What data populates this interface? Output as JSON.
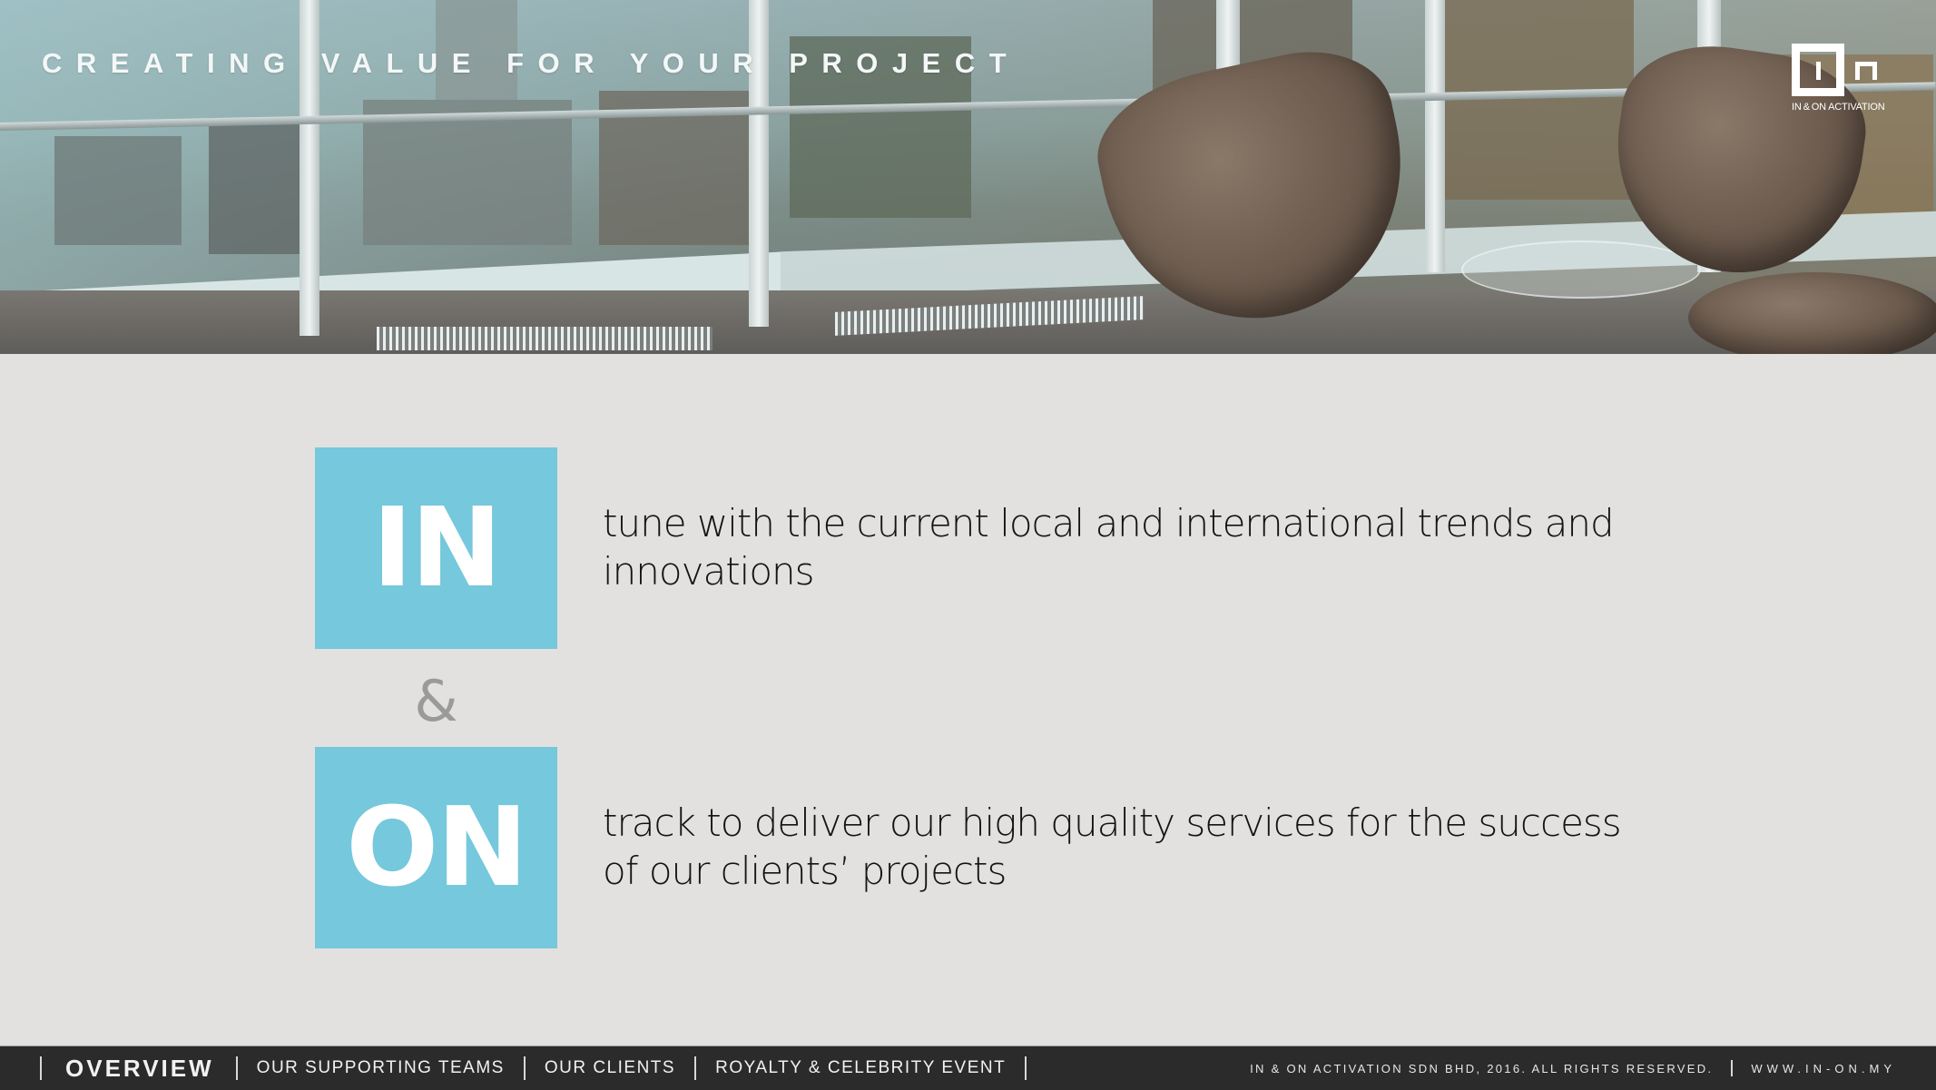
{
  "hero": {
    "title": "CREATING VALUE FOR YOUR PROJECT",
    "image_description": "office lounge with two brown chairs and glass table overlooking city skyline",
    "logo": {
      "mark": "I n",
      "caption": "IN & ON ACTIVATION"
    }
  },
  "main": {
    "blocks": [
      {
        "tile": "IN",
        "text": "tune with the current local and international trends and innovations"
      },
      {
        "tile": "ON",
        "text": "track to deliver our high quality services for the success of our clients’ projects"
      }
    ],
    "connector": "&"
  },
  "footer": {
    "nav": [
      {
        "label": "OVERVIEW",
        "active": true
      },
      {
        "label": "OUR SUPPORTING TEAMS",
        "active": false
      },
      {
        "label": "OUR CLIENTS",
        "active": false
      },
      {
        "label": "ROYALTY & CELEBRITY EVENT",
        "active": false
      }
    ],
    "copyright": "IN & ON ACTIVATION SDN BHD, 2016. ALL RIGHTS RESERVED.",
    "website": "WWW.IN-ON.MY"
  },
  "colors": {
    "tile": "#76c8dc",
    "background": "#e2e1e0",
    "footer": "#2b2b2b",
    "ampersand": "#9a9a9a"
  }
}
